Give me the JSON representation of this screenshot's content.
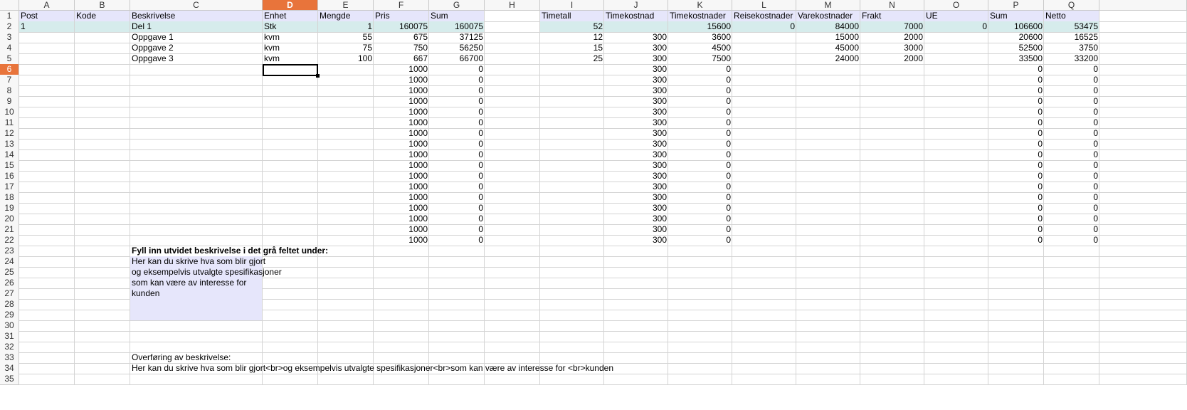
{
  "sheet": {
    "columns": [
      "A",
      "B",
      "C",
      "D",
      "E",
      "F",
      "G",
      "H",
      "I",
      "J",
      "K",
      "L",
      "M",
      "N",
      "O",
      "P",
      "Q"
    ],
    "selected_column": "D",
    "selected_row": 6,
    "rows": 35,
    "colors": {
      "header_fill": "#e6e6fb",
      "del_row_fill": "#d6ecec",
      "selection_accent": "#e8743b",
      "description_box": "#e6e6fb"
    },
    "cells": [
      {
        "r": 1,
        "c": "A",
        "v": "Post"
      },
      {
        "r": 1,
        "c": "B",
        "v": "Kode"
      },
      {
        "r": 1,
        "c": "C",
        "v": "Beskrivelse"
      },
      {
        "r": 1,
        "c": "D",
        "v": "Enhet"
      },
      {
        "r": 1,
        "c": "E",
        "v": "Mengde"
      },
      {
        "r": 1,
        "c": "F",
        "v": "Pris"
      },
      {
        "r": 1,
        "c": "G",
        "v": "Sum"
      },
      {
        "r": 1,
        "c": "I",
        "v": "Timetall"
      },
      {
        "r": 1,
        "c": "J",
        "v": "Timekostnad"
      },
      {
        "r": 1,
        "c": "K",
        "v": "Timekostnader"
      },
      {
        "r": 1,
        "c": "L",
        "v": "Reisekostnader"
      },
      {
        "r": 1,
        "c": "M",
        "v": "Varekostnader"
      },
      {
        "r": 1,
        "c": "N",
        "v": "Frakt"
      },
      {
        "r": 1,
        "c": "O",
        "v": "UE"
      },
      {
        "r": 1,
        "c": "P",
        "v": "Sum"
      },
      {
        "r": 1,
        "c": "Q",
        "v": "Netto"
      },
      {
        "r": 2,
        "c": "A",
        "v": "1"
      },
      {
        "r": 2,
        "c": "C",
        "v": "Del 1"
      },
      {
        "r": 2,
        "c": "D",
        "v": "Stk"
      },
      {
        "r": 2,
        "c": "E",
        "v": "1",
        "n": true
      },
      {
        "r": 2,
        "c": "F",
        "v": "160075",
        "n": true
      },
      {
        "r": 2,
        "c": "G",
        "v": "160075",
        "n": true
      },
      {
        "r": 2,
        "c": "I",
        "v": "52",
        "n": true
      },
      {
        "r": 2,
        "c": "K",
        "v": "15600",
        "n": true
      },
      {
        "r": 2,
        "c": "L",
        "v": "0",
        "n": true
      },
      {
        "r": 2,
        "c": "M",
        "v": "84000",
        "n": true
      },
      {
        "r": 2,
        "c": "N",
        "v": "7000",
        "n": true
      },
      {
        "r": 2,
        "c": "O",
        "v": "0",
        "n": true
      },
      {
        "r": 2,
        "c": "P",
        "v": "106600",
        "n": true
      },
      {
        "r": 2,
        "c": "Q",
        "v": "53475",
        "n": true
      },
      {
        "r": 3,
        "c": "C",
        "v": "Oppgave 1"
      },
      {
        "r": 3,
        "c": "D",
        "v": "kvm"
      },
      {
        "r": 3,
        "c": "E",
        "v": "55",
        "n": true
      },
      {
        "r": 3,
        "c": "F",
        "v": "675",
        "n": true
      },
      {
        "r": 3,
        "c": "G",
        "v": "37125",
        "n": true
      },
      {
        "r": 3,
        "c": "I",
        "v": "12",
        "n": true
      },
      {
        "r": 3,
        "c": "J",
        "v": "300",
        "n": true
      },
      {
        "r": 3,
        "c": "K",
        "v": "3600",
        "n": true
      },
      {
        "r": 3,
        "c": "M",
        "v": "15000",
        "n": true
      },
      {
        "r": 3,
        "c": "N",
        "v": "2000",
        "n": true
      },
      {
        "r": 3,
        "c": "P",
        "v": "20600",
        "n": true
      },
      {
        "r": 3,
        "c": "Q",
        "v": "16525",
        "n": true
      },
      {
        "r": 4,
        "c": "C",
        "v": "Oppgave 2"
      },
      {
        "r": 4,
        "c": "D",
        "v": "kvm"
      },
      {
        "r": 4,
        "c": "E",
        "v": "75",
        "n": true
      },
      {
        "r": 4,
        "c": "F",
        "v": "750",
        "n": true
      },
      {
        "r": 4,
        "c": "G",
        "v": "56250",
        "n": true
      },
      {
        "r": 4,
        "c": "I",
        "v": "15",
        "n": true
      },
      {
        "r": 4,
        "c": "J",
        "v": "300",
        "n": true
      },
      {
        "r": 4,
        "c": "K",
        "v": "4500",
        "n": true
      },
      {
        "r": 4,
        "c": "M",
        "v": "45000",
        "n": true
      },
      {
        "r": 4,
        "c": "N",
        "v": "3000",
        "n": true
      },
      {
        "r": 4,
        "c": "P",
        "v": "52500",
        "n": true
      },
      {
        "r": 4,
        "c": "Q",
        "v": "3750",
        "n": true
      },
      {
        "r": 5,
        "c": "C",
        "v": "Oppgave 3"
      },
      {
        "r": 5,
        "c": "D",
        "v": "kvm"
      },
      {
        "r": 5,
        "c": "E",
        "v": "100",
        "n": true
      },
      {
        "r": 5,
        "c": "F",
        "v": "667",
        "n": true
      },
      {
        "r": 5,
        "c": "G",
        "v": "66700",
        "n": true
      },
      {
        "r": 5,
        "c": "I",
        "v": "25",
        "n": true
      },
      {
        "r": 5,
        "c": "J",
        "v": "300",
        "n": true
      },
      {
        "r": 5,
        "c": "K",
        "v": "7500",
        "n": true
      },
      {
        "r": 5,
        "c": "M",
        "v": "24000",
        "n": true
      },
      {
        "r": 5,
        "c": "N",
        "v": "2000",
        "n": true
      },
      {
        "r": 5,
        "c": "P",
        "v": "33500",
        "n": true
      },
      {
        "r": 5,
        "c": "Q",
        "v": "33200",
        "n": true
      },
      {
        "r": 23,
        "c": "C",
        "v": "Fyll inn utvidet beskrivelse i det grå feltet under:",
        "b": true
      },
      {
        "r": 24,
        "c": "C",
        "v": "Her kan du skrive hva som blir gjort"
      },
      {
        "r": 25,
        "c": "C",
        "v": "og eksempelvis utvalgte spesifikasjoner"
      },
      {
        "r": 26,
        "c": "C",
        "v": "som kan være av interesse for"
      },
      {
        "r": 27,
        "c": "C",
        "v": "kunden"
      },
      {
        "r": 33,
        "c": "C",
        "v": "Overføring av beskrivelse:"
      },
      {
        "r": 34,
        "c": "C",
        "v": "Her kan du skrive hva som blir gjort<br>og eksempelvis utvalgte spesifikasjoner<br>som kan være av interesse for <br>kunden"
      }
    ],
    "repeat_rows": {
      "from": 6,
      "to": 22,
      "values": {
        "F": "1000",
        "G": "0",
        "J": "300",
        "K": "0",
        "P": "0",
        "Q": "0"
      }
    }
  }
}
